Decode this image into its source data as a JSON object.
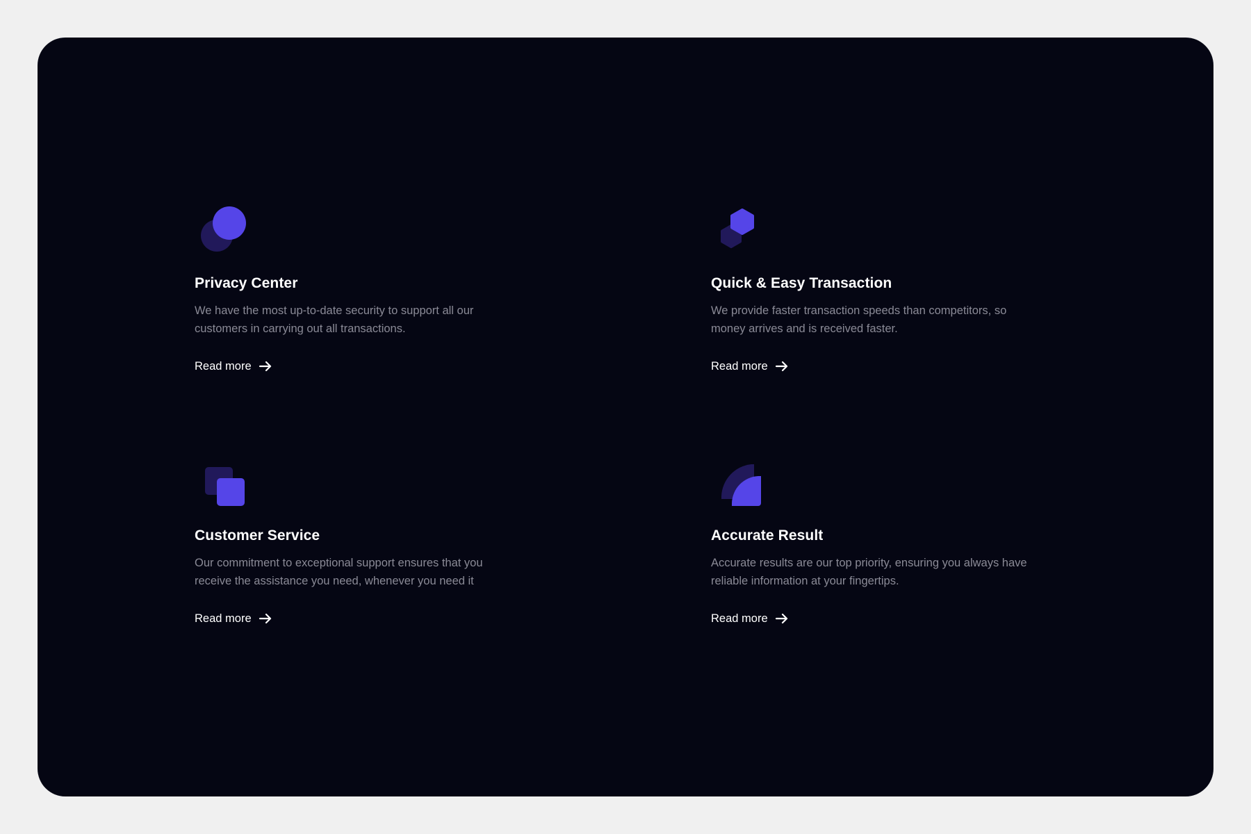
{
  "accent_color": "#5545e8",
  "accent_dark_color": "#21195a",
  "background_color": "#050613",
  "features": [
    {
      "icon": "overlapping-circles-icon",
      "title": "Privacy Center",
      "description": "We have the most up-to-date security to support all our customers in carrying out all transactions.",
      "link_label": "Read more"
    },
    {
      "icon": "hexagon-icon",
      "title": "Quick & Easy Transaction",
      "description": "We provide faster transaction speeds than competitors, so money arrives and is received faster.",
      "link_label": "Read more"
    },
    {
      "icon": "overlapping-squares-icon",
      "title": "Customer Service",
      "description": "Our commitment to exceptional support ensures that you receive the assistance you need, whenever you need it",
      "link_label": "Read more"
    },
    {
      "icon": "quarter-circle-icon",
      "title": "Accurate Result",
      "description": "Accurate results are our top priority, ensuring you always have reliable information at your fingertips.",
      "link_label": "Read more"
    }
  ]
}
